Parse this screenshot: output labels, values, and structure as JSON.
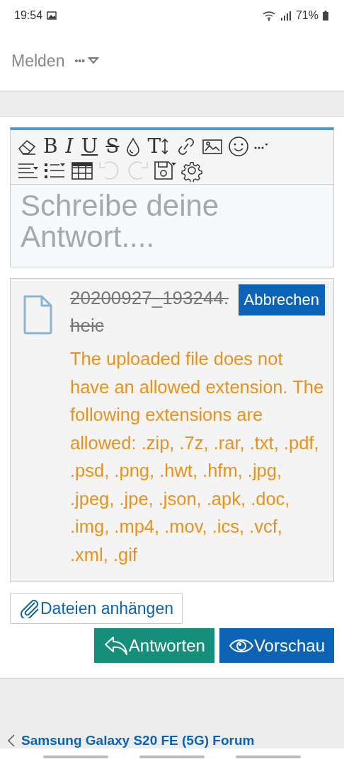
{
  "status_bar": {
    "time": "19:54",
    "battery": "71%"
  },
  "post_actions": {
    "report": "Melden",
    "more": "•••"
  },
  "editor": {
    "toolbar_rows": [
      [
        {
          "kind": "icon"
        },
        {
          "kind": "glyph",
          "label": "B"
        },
        {
          "kind": "glyph",
          "label": "I"
        },
        {
          "kind": "glyph",
          "label": "U"
        },
        {
          "kind": "glyph",
          "label": "S"
        },
        {
          "kind": "icon"
        },
        {
          "kind": "glyph",
          "label": "T"
        },
        {
          "kind": "icon"
        },
        {
          "kind": "icon"
        },
        {
          "kind": "icon"
        },
        {
          "kind": "icon"
        }
      ],
      [
        {
          "kind": "icon",
          "disabled": false
        },
        {
          "kind": "icon",
          "disabled": false
        },
        {
          "kind": "icon",
          "disabled": false
        },
        {
          "kind": "icon",
          "disabled": true
        },
        {
          "kind": "icon",
          "disabled": true
        },
        {
          "kind": "icon",
          "disabled": false
        },
        {
          "kind": "icon",
          "disabled": false
        }
      ]
    ],
    "placeholder": "Schreibe deine Antwort...."
  },
  "attachment": {
    "filename": "20200927_193244.heic",
    "rejected": true,
    "cancel": "Abbrechen",
    "error": "The uploaded file does not have an allowed extension. The following extensions are allowed: .zip, .7z, .rar, .txt, .pdf, .psd, .png, .hwt, .hfm, .jpg, .jpeg, .jpe, .json, .apk, .doc, .img, .mp4, .mov, .ics, .vcf, .xml, .gif"
  },
  "attach_button": "Dateien anhängen",
  "buttons": [
    {
      "kind": "reply",
      "label": "Antworten"
    },
    {
      "kind": "preview",
      "label": "Vorschau"
    }
  ],
  "breadcrumb": "Samsung Galaxy S20 FE (5G) Forum"
}
